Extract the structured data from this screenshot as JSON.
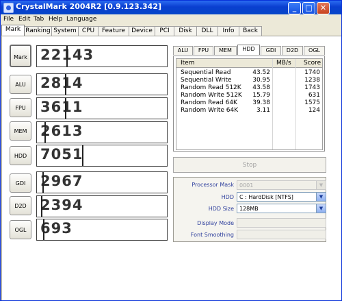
{
  "window": {
    "title": "CrystalMark 2004R2 [0.9.123.342]",
    "controls": {
      "minimize": "_",
      "maximize": "□",
      "close": "✕"
    }
  },
  "menu": [
    "File",
    "Edit",
    "Tab",
    "Help",
    "Language"
  ],
  "tabs": [
    "Mark",
    "Ranking",
    "System",
    "CPU",
    "Feature",
    "Device",
    "PCI",
    "Disk",
    "DLL",
    "Info",
    "Back"
  ],
  "active_tab": "Mark",
  "scores": [
    {
      "label": "Mark",
      "value": "22143",
      "fill": 0.23
    },
    {
      "label": "ALU",
      "value": "2814",
      "fill": 0.22
    },
    {
      "label": "FPU",
      "value": "3611",
      "fill": 0.22
    },
    {
      "label": "MEM",
      "value": "2613",
      "fill": 0.06
    },
    {
      "label": "HDD",
      "value": "7051",
      "fill": 0.35
    },
    {
      "label": "GDI",
      "value": "2967",
      "fill": 0.04
    },
    {
      "label": "D2D",
      "value": "2394",
      "fill": 0.03
    },
    {
      "label": "OGL",
      "value": "693",
      "fill": 0.05
    }
  ],
  "detail_tabs": [
    "ALU",
    "FPU",
    "MEM",
    "HDD",
    "GDI",
    "D2D",
    "OGL"
  ],
  "active_detail_tab": "HDD",
  "table": {
    "headers": [
      "Item",
      "MB/s",
      "Score"
    ],
    "rows": [
      {
        "item": "Sequential Read",
        "mbs": "43.52",
        "score": "1740"
      },
      {
        "item": "Sequential Write",
        "mbs": "30.95",
        "score": "1238"
      },
      {
        "item": "Random Read 512K",
        "mbs": "43.58",
        "score": "1743"
      },
      {
        "item": "Random Write 512K",
        "mbs": "15.79",
        "score": "631"
      },
      {
        "item": "Random Read 64K",
        "mbs": "39.38",
        "score": "1575"
      },
      {
        "item": "Random Write 64K",
        "mbs": "3.11",
        "score": "124"
      }
    ]
  },
  "stop_button": "Stop",
  "settings": {
    "processor_mask": {
      "label": "Processor Mask",
      "value": "0001"
    },
    "hdd": {
      "label": "HDD",
      "value": "C : HardDisk [NTFS]"
    },
    "hdd_size": {
      "label": "HDD Size",
      "value": "128MB"
    },
    "display_mode": {
      "label": "Display Mode",
      "value": ""
    },
    "font_smoothing": {
      "label": "Font Smoothing",
      "value": ""
    }
  }
}
